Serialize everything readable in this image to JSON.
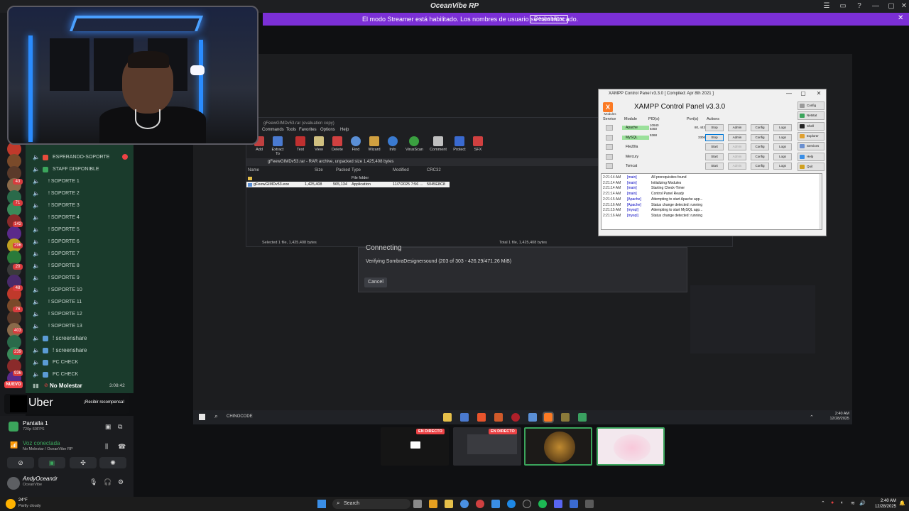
{
  "window": {
    "title": "OceanVibe RP",
    "controls": [
      "☰",
      "▭",
      "?",
      "—",
      "▢",
      "✕"
    ]
  },
  "banner": {
    "message": "El modo Streamer está habilitado. Los nombres de usuario se han truncado.",
    "button": "Deshabilitar",
    "close": "✕"
  },
  "server_badges": [
    "43",
    "71",
    "142",
    "296",
    "20",
    "48",
    "76",
    "403",
    "239",
    "936"
  ],
  "channels": [
    {
      "label": "ESPERANDO-SOPORTE",
      "icon_color": "#e74c3c"
    },
    {
      "label": "STAFF DISPONIBLE",
      "icon_color": "#3ba55c"
    },
    {
      "label": "! SOPORTE 1",
      "icon_color": ""
    },
    {
      "label": "! SOPORTE 2",
      "icon_color": ""
    },
    {
      "label": "! SOPORTE 3",
      "icon_color": ""
    },
    {
      "label": "! SOPORTE 4",
      "icon_color": ""
    },
    {
      "label": "! SOPORTE 5",
      "icon_color": ""
    },
    {
      "label": "! SOPORTE 6",
      "icon_color": ""
    },
    {
      "label": "! SOPORTE 7",
      "icon_color": ""
    },
    {
      "label": "! SOPORTE 8",
      "icon_color": ""
    },
    {
      "label": "! SOPORTE 9",
      "icon_color": ""
    },
    {
      "label": "! SOPORTE 10",
      "icon_color": ""
    },
    {
      "label": "! SOPORTE 11",
      "icon_color": ""
    },
    {
      "label": "! SOPORTE 12",
      "icon_color": ""
    },
    {
      "label": "! SOPORTE 13",
      "icon_color": ""
    },
    {
      "label": "! screenshare",
      "icon_color": "#5b9bd5"
    },
    {
      "label": "! screenshare",
      "icon_color": "#5b9bd5"
    },
    {
      "label": "PC CHECK",
      "icon_color": "#5b9bd5"
    },
    {
      "label": "PC CHECK",
      "icon_color": "#5b9bd5"
    }
  ],
  "current_channel": {
    "label": "No Molestar",
    "timer": "3:08:42",
    "new_badge": "NUEVO"
  },
  "winrar": {
    "title": "gFeewGIMDv53.rar (evaluation copy)",
    "menu": [
      "Commands",
      "Tools",
      "Favorites",
      "Options",
      "Help"
    ],
    "toolbar": [
      "Add",
      "Extract To",
      "Test",
      "View",
      "Delete",
      "Find",
      "Wizard",
      "Info",
      "VirusScan",
      "Comment",
      "Protect",
      "SFX"
    ],
    "path": "gFeewGIMDv53.rar - RAR archive, unpacked size 1,425,408 bytes",
    "columns": [
      "Name",
      "Size",
      "Packed",
      "Type",
      "Modified",
      "CRC32"
    ],
    "rows": [
      {
        "name": "..",
        "size": "",
        "packed": "",
        "type": "File folder",
        "modified": "",
        "crc": ""
      },
      {
        "name": "gFeewGIMDv53.exe",
        "size": "1,425,408",
        "packed": "565,134",
        "type": "Application",
        "modified": "11/7/2025 7:56 ...",
        "crc": "5045E8C8"
      }
    ],
    "status_left": "Selected 1 file, 1,425,408 bytes",
    "status_right": "Total 1 file, 1,425,408 bytes"
  },
  "dialog": {
    "heading": "Connecting",
    "verify": "Verifying SombraDesignersound (203 of 303 - 426.29/471.26 MiB)",
    "cancel": "Cancel"
  },
  "xampp": {
    "window_title": "XAMPP Control Panel v3.3.0   [ Compiled: Apr 8th 2021 ]",
    "heading": "XAMPP Control Panel v3.3.0",
    "modules_label": "Modules",
    "columns": [
      "Service",
      "Module",
      "PID(s)",
      "Port(s)",
      "Actions"
    ],
    "rows": [
      {
        "module": "Apache",
        "pid": "10940\n8460",
        "port": "80, 443",
        "action": "Stop",
        "running": true
      },
      {
        "module": "MySQL",
        "pid": "5368",
        "port": "3306",
        "action": "Stop",
        "running": true
      },
      {
        "module": "FileZilla",
        "pid": "",
        "port": "",
        "action": "Start",
        "running": false
      },
      {
        "module": "Mercury",
        "pid": "",
        "port": "",
        "action": "Start",
        "running": false
      },
      {
        "module": "Tomcat",
        "pid": "",
        "port": "",
        "action": "Start",
        "running": false
      }
    ],
    "row_buttons": [
      "Admin",
      "Config",
      "Logs"
    ],
    "side_buttons": [
      {
        "label": "Config",
        "color": "#9a9a9a"
      },
      {
        "label": "Netstat",
        "color": "#3ba55c"
      },
      {
        "label": "Shell",
        "color": "#222"
      },
      {
        "label": "Explorer",
        "color": "#e0a030"
      },
      {
        "label": "Services",
        "color": "#6a8fd0"
      },
      {
        "label": "Help",
        "color": "#3a8ee6"
      },
      {
        "label": "Quit",
        "color": "#d0a020"
      }
    ],
    "log": [
      {
        "t": "2:21:14 AM",
        "mod": "[main]",
        "msg": "All prerequisites found"
      },
      {
        "t": "2:21:14 AM",
        "mod": "[main]",
        "msg": "Initializing Modules"
      },
      {
        "t": "2:21:14 AM",
        "mod": "[main]",
        "msg": "Starting Check-Timer"
      },
      {
        "t": "2:21:14 AM",
        "mod": "[main]",
        "msg": "Control Panel Ready"
      },
      {
        "t": "2:21:15 AM",
        "mod": "[Apache]",
        "msg": "Attempting to start Apache app..."
      },
      {
        "t": "2:21:16 AM",
        "mod": "[Apache]",
        "msg": "Status change detected: running"
      },
      {
        "t": "2:21:15 AM",
        "mod": "[mysql]",
        "msg": "Attempting to start MySQL app..."
      },
      {
        "t": "2:21:16 AM",
        "mod": "[mysql]",
        "msg": "Status change detected: running"
      }
    ]
  },
  "inner_taskbar": {
    "text": "CHINOCODE",
    "time": "2:40 AM",
    "date": "12/28/2025"
  },
  "uber": {
    "name": "Uber",
    "cta": "¡Recibir recompensa!"
  },
  "panels": {
    "screen_title": "Pantalla 1",
    "screen_res": "720p 60FPS",
    "voice_status": "Voz conectada",
    "voice_channel": "No Molestar / OceanVibe RP",
    "user_name": "AndyOceandr",
    "user_server": "OceanVibe"
  },
  "thumbs": {
    "live_label": "EN DIRECTO"
  },
  "taskbar": {
    "weather_temp": "24°F",
    "weather_desc": "Partly cloudy",
    "search": "Search",
    "time": "2:40 AM",
    "date": "12/28/2025"
  }
}
